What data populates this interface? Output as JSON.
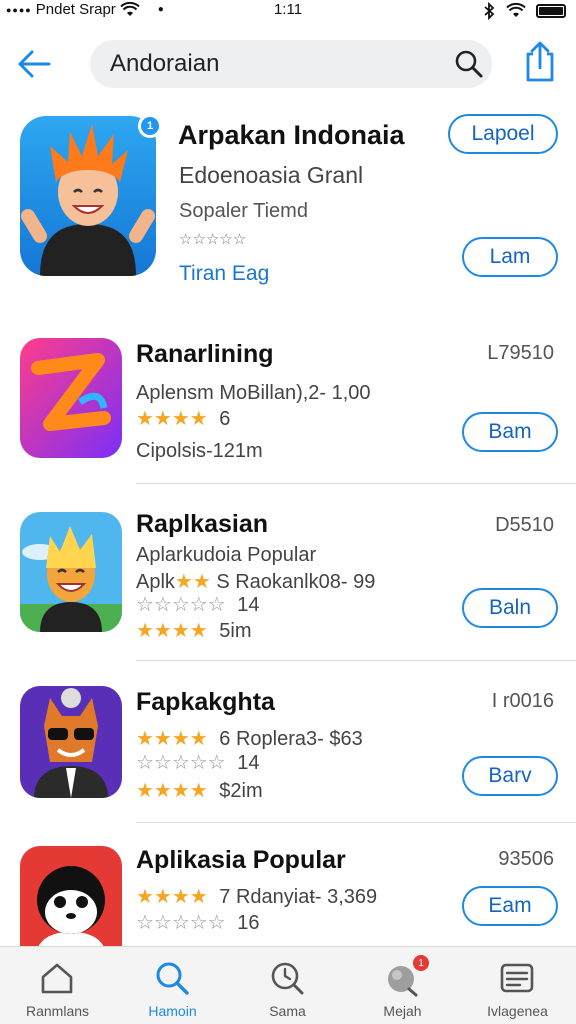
{
  "status_bar": {
    "carrier": "Pndet Srapr",
    "time": "1:11",
    "battery_level": 0.95
  },
  "header": {
    "search_value": "Andoraian",
    "back_icon": "arrow-left-icon",
    "search_icon": "search-icon",
    "share_icon": "share-icon"
  },
  "featured": {
    "badge": "1",
    "title": "Arpakan Indonaia",
    "subtitle": "Edoenoasia Granl",
    "developer": "Sopaler Tiemd",
    "rating_text": "☆☆☆☆☆",
    "link": "Tiran Eag",
    "primary_button": "Lapoel",
    "secondary_button": "Lam"
  },
  "apps": [
    {
      "title": "Ranarlining",
      "code": "L79510",
      "line1": "Aplensm MoBillan),2- 1,00",
      "rating_stars": "★★★★",
      "rating_suffix": "6",
      "line3": "Cipolsis-121m",
      "button": "Bam"
    },
    {
      "title": "Raplkasian",
      "code": "D5510",
      "line1": "Aplarkudoia Popular",
      "line2_prefix": "Aplk",
      "line2_stars": "★★",
      "line2_suffix": "S  Raokanlk08- 99",
      "empty_stars": "☆☆☆☆☆",
      "empty_count": "14",
      "rating_stars": "★★★★",
      "rating_suffix": "5im",
      "button": "Baln"
    },
    {
      "title": "Fapkakghta",
      "code": "I r0016",
      "rating_stars": "★★★★",
      "line1": "6  Roplera3- $63",
      "empty_stars": "☆☆☆☆☆",
      "empty_count": "14",
      "rating_stars2": "★★★★",
      "rating_suffix": "$2im",
      "button": "Barv"
    },
    {
      "title": "Aplikasia Popular",
      "code": "93506",
      "rating_stars": "★★★★",
      "line1": "7  Rdanyiaŧ- 3,369",
      "empty_stars": "☆☆☆☆☆",
      "empty_count": "16",
      "button": "Eam"
    }
  ],
  "tabs": [
    {
      "label": "Ranmlans",
      "icon": "home-icon",
      "active": false
    },
    {
      "label": "Hamoin",
      "icon": "search-icon",
      "active": true
    },
    {
      "label": "Sama",
      "icon": "clock-search-icon",
      "active": false
    },
    {
      "label": "Mejah",
      "icon": "globe-icon",
      "active": false,
      "badge": "1"
    },
    {
      "label": "Ivlagenea",
      "icon": "list-icon",
      "active": false
    }
  ],
  "colors": {
    "accent": "#1e88e5",
    "star": "#f5a623",
    "badge": "#e53935"
  }
}
